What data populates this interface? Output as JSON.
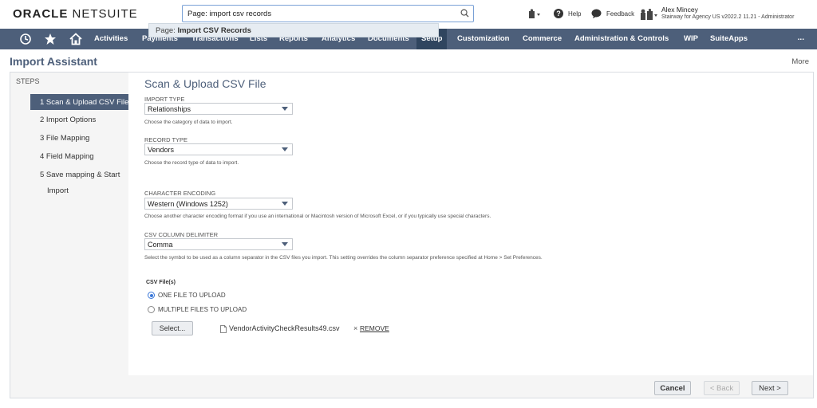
{
  "header": {
    "logo_oracle": "ORACLE",
    "logo_netsuite": "NETSUITE",
    "search_value": "Page: import csv records",
    "suggestion_prefix": "Page:",
    "suggestion_match": "Import CSV Records",
    "help_label": "Help",
    "feedback_label": "Feedback",
    "user_name": "Alex Mincey",
    "user_role": "Stairway for Agency US v2022.2 11.21 - Administrator"
  },
  "nav": {
    "items": [
      "Activities",
      "Payments",
      "Transactions",
      "Lists",
      "Reports",
      "Analytics",
      "Documents",
      "Setup",
      "Customization",
      "Commerce",
      "Administration & Controls",
      "WIP",
      "SuiteApps"
    ],
    "more": "...",
    "active": "Setup"
  },
  "page": {
    "title": "Import Assistant",
    "more": "More"
  },
  "steps": {
    "title": "STEPS",
    "items": [
      "1 Scan & Upload CSV File",
      "2 Import Options",
      "3 File Mapping",
      "4 Field Mapping",
      "5 Save mapping & Start",
      "Import"
    ]
  },
  "form": {
    "section_title": "Scan & Upload CSV File",
    "import_type_label": "IMPORT TYPE",
    "import_type_value": "Relationships",
    "import_type_help": "Choose the category of data to import.",
    "record_type_label": "RECORD TYPE",
    "record_type_value": "Vendors",
    "record_type_help": "Choose the record type of data to import.",
    "encoding_label": "CHARACTER ENCODING",
    "encoding_value": "Western (Windows 1252)",
    "encoding_help": "Choose another character encoding format if you use an international or Macintosh version of Microsoft Excel, or if you typically use special characters.",
    "delimiter_label": "CSV COLUMN DELIMITER",
    "delimiter_value": "Comma",
    "delimiter_help": "Select the symbol to be used as a column separator in the CSV files you import. This setting overrides the column separator preference specified at Home > Set Preferences.",
    "csv_title": "CSV File(s)",
    "radio_one": "ONE FILE TO UPLOAD",
    "radio_multi": "MULTIPLE FILES TO UPLOAD",
    "select_button": "Select...",
    "file_name": "VendorActivityCheckResults49.csv",
    "remove_x": "×",
    "remove_label": "REMOVE"
  },
  "footer": {
    "cancel": "Cancel",
    "back": "< Back",
    "next": "Next >"
  },
  "colors": {
    "nav_bg": "#4d5f7a",
    "nav_active": "#30455f",
    "accent": "#3b78d8"
  }
}
